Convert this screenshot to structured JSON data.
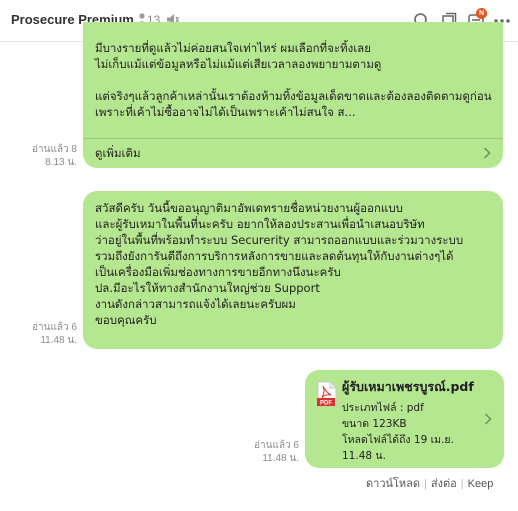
{
  "header": {
    "title": "Prosecure Premium",
    "member_count": "13",
    "notification_badge": "N",
    "badge_color": "#e8541e",
    "icons": [
      "member-icon",
      "mute-icon",
      "search-icon",
      "note-icon",
      "notification-icon",
      "more-icon"
    ]
  },
  "messages": [
    {
      "lines": [
        "มีบางรายที่ดูแล้วไม่ค่อยสนใจเท่าไหร่ ผมเลือกที่จะทิ้งเลย",
        "ไม่เก็บแม้แต่ข้อมูลหรือไม่แม้แต่เสียเวลาลองพยายามตามดู",
        "",
        "แต่จริงๆแล้วลูกค้าเหล่านั้นเราต้องห้ามทิ้งข้อมูลเด็ดขาดและต้องลองติดตามดูก่อน",
        "เพราะที่เค้าไม่ซื้ออาจไม่ได้เป็นเพราะเค้าไม่สนใจ ส..."
      ],
      "see_more": "ดูเพิ่มเติม",
      "read": "อ่านแล้ว 8",
      "time": "8.13 น."
    },
    {
      "lines": [
        "สวัสดีครับ วันนี้ขออนุญาติมาอัพเดทรายชื่อหน่วยงานผู้ออกแบบ",
        "และผู้รับเหมาในพื้นที่นะครับ อยากให้ลองประสานเพื่อนำเสนอบริษัท",
        "ว่าอยู่ในพื้นที่พร้อมทำระบบ Securerity สามารถออกแบบและร่วมวางระบบ",
        "รวมถึงยังการันตีถึงการบริการหลังการขายและลดต้นทุนให้กับงานต่างๆได้",
        "เป็นเครื่องมือเพิ่มช่องทางการขายอีกทางนึงนะครับ",
        "ปล.มีอะไรให้ทางสำนักงานใหญ่ช่วย Support",
        "งานดังกล่าวสามารถแจ้งได้เลยนะครับผม",
        "ขอบคุณครับ"
      ],
      "read": "อ่านแล้ว 6",
      "time": "11.48 น."
    }
  ],
  "file_message": {
    "file_name": "ผู้รับเหมาเพชรบูรณ์.pdf",
    "file_type": "ประเภทไฟล์ : pdf",
    "size": "ขนาด 123KB",
    "download_until": "โหลดไฟล์ได้ถึง 19 เม.ย.",
    "download_time": "11.48 น.",
    "icon_label": "PDF",
    "read": "อ่านแล้ว 6",
    "time": "11.48 น."
  },
  "actions": {
    "download": "ดาวน์โหลด",
    "share": "ส่งต่อ",
    "keep": "Keep"
  },
  "colors": {
    "bubble": "#b5e690",
    "pdf_red": "#d9342b"
  }
}
